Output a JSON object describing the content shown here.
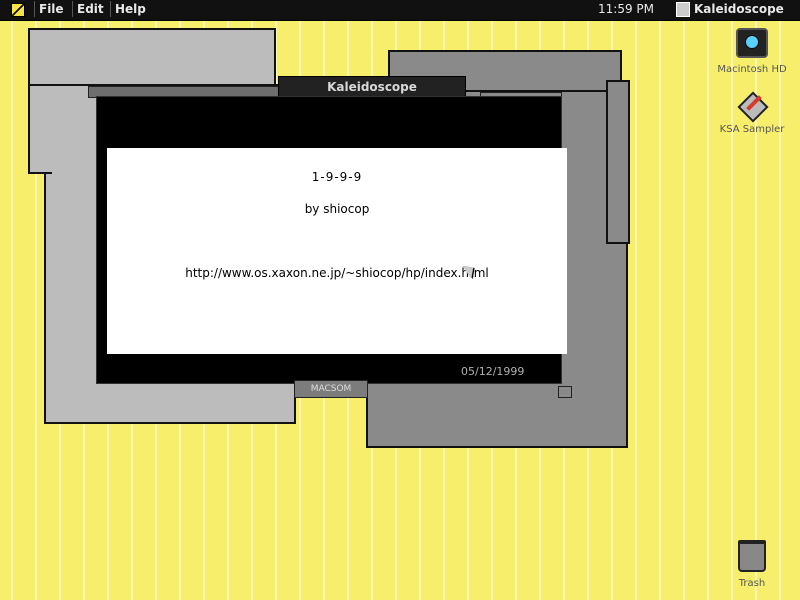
{
  "menubar": {
    "apple_label": "",
    "items": [
      {
        "label": "File"
      },
      {
        "label": "Edit"
      },
      {
        "label": "Help"
      }
    ],
    "clock": "11:59 PM",
    "app_name": "Kaleidoscope"
  },
  "window": {
    "title": "Kaleidoscope",
    "version": "1-9-9-9",
    "author": "by shiocop",
    "url": "http://www.os.xaxon.ne.jp/~shiocop/hp/index.html",
    "date": "05/12/1999",
    "bottom_tab": "MACSOM"
  },
  "desktop": {
    "icons": [
      {
        "label": "Macintosh HD",
        "icon": "hard-drive-icon"
      },
      {
        "label": "KSA Sampler",
        "icon": "ksa-sampler-icon"
      },
      {
        "label": "Trash",
        "icon": "trash-icon"
      }
    ]
  },
  "colors": {
    "desktop_yellow": "#f7ee6c",
    "panel_light": "#bcbcbc",
    "panel_dark": "#8a8a8a",
    "window_black": "#000000"
  }
}
